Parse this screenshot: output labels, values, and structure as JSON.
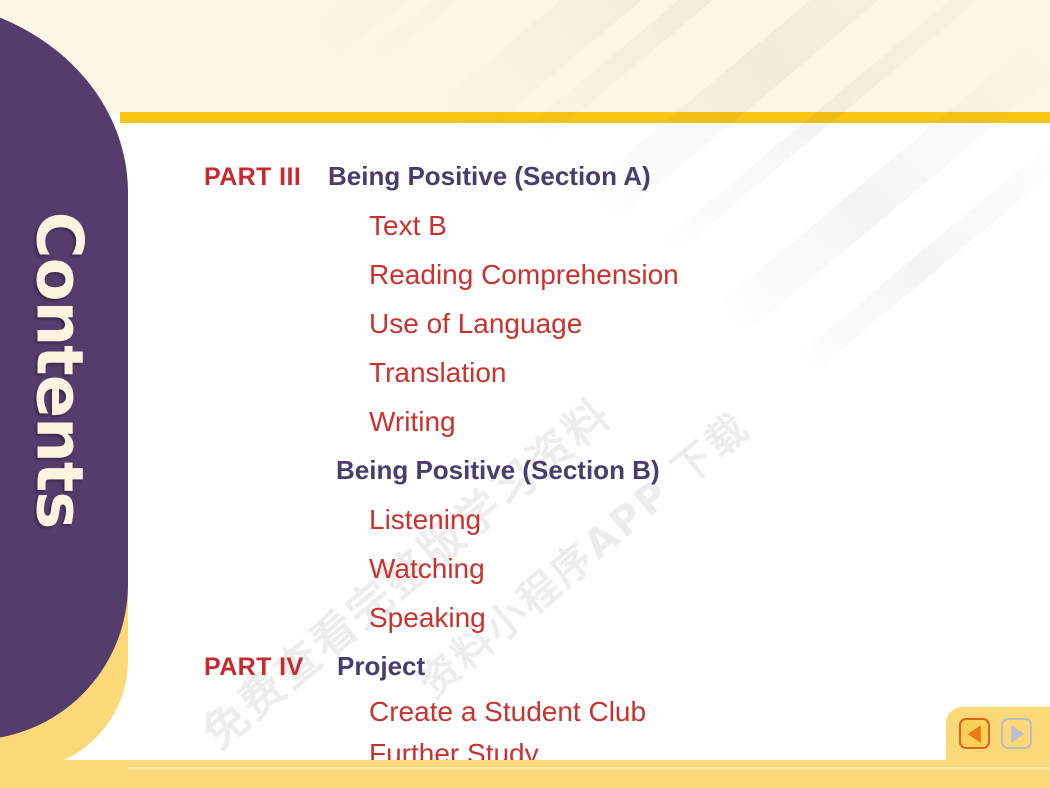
{
  "slide": {
    "sidebar_label": "Contents",
    "colors": {
      "purple_band": "#543C6C",
      "cream_header": "#FDF6E4",
      "gold_rule": "#F9C412",
      "gold_strip": "#FCD978",
      "heading_purple": "#4B3C6E",
      "item_red": "#C9322F",
      "part_red": "#C62B30"
    }
  },
  "watermark": {
    "line1": "免费查看完整版学习资料",
    "line2": "资料小程序APP 下载"
  },
  "toc": {
    "rows": [
      {
        "part": "PART III",
        "heading": "Being Positive (Section A)",
        "item": ""
      },
      {
        "part": "",
        "heading": "",
        "item": "Text B"
      },
      {
        "part": "",
        "heading": "",
        "item": "Reading Comprehension"
      },
      {
        "part": "",
        "heading": "",
        "item": "Use of Language"
      },
      {
        "part": "",
        "heading": "",
        "item": "Translation"
      },
      {
        "part": "",
        "heading": "",
        "item": "Writing"
      },
      {
        "part": "",
        "heading": "Being Positive (Section B)",
        "item": ""
      },
      {
        "part": "",
        "heading": "",
        "item": "Listening"
      },
      {
        "part": "",
        "heading": "",
        "item": "Watching"
      },
      {
        "part": "",
        "heading": "",
        "item": "Speaking"
      },
      {
        "part": "PART IV",
        "heading": "Project",
        "item": ""
      },
      {
        "part": "",
        "heading": "",
        "item": "Create a Student Club"
      },
      {
        "part": "",
        "heading": "",
        "item": "Further Study"
      }
    ]
  },
  "navigation": {
    "prev_label": "◀",
    "next_label": "▶",
    "prev_name": "previous-slide",
    "next_name": "next-slide"
  }
}
